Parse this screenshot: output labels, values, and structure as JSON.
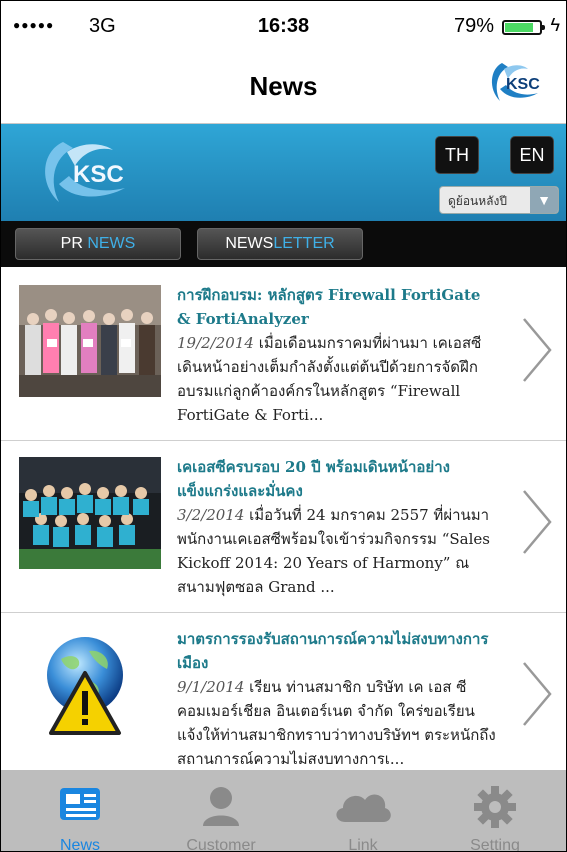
{
  "status_bar": {
    "signal_dots": "●●●●●",
    "network": "3G",
    "time": "16:38",
    "battery_percent": "79%",
    "battery_level": 0.79,
    "charging_icon": "bolt-icon"
  },
  "nav": {
    "title": "News",
    "logo_text": "KSC"
  },
  "banner": {
    "logo_text": "KSC",
    "lang_th": "TH",
    "lang_en": "EN",
    "year_select": "ดูย้อนหลังปี"
  },
  "tabs": {
    "pr_a": "PR ",
    "pr_b": "NEWS",
    "nl_a": "NEWS",
    "nl_b": "LETTER"
  },
  "news": [
    {
      "title": "การฝึกอบรม: หลักสูตร Firewall FortiGate & FortiAnalyzer",
      "date": "19/2/2014",
      "excerpt": "  เมื่อเดือนมกราคมที่ผ่านมา เคเอสซีเดินหน้าอย่างเต็มกำลังตั้งแต่ต้นปีด้วยการจัดฝึกอบรมแก่ลูกค้าองค์กรในหลักสูตร “Firewall FortiGate & Forti..."
    },
    {
      "title": "เคเอสซีครบรอบ 20 ปี พร้อมเดินหน้าอย่างแข็งแกร่งและมั่นคง",
      "date": "3/2/2014",
      "excerpt": "  เมื่อวันที่ 24 มกราคม 2557 ที่ผ่านมา พนักงานเคเอสซีพร้อมใจเข้าร่วมกิจกรรม “Sales Kickoff 2014: 20 Years of Harmony” ณ สนามฟุตซอล Grand ..."
    },
    {
      "title": "มาตรการรองรับสถานการณ์ความไม่สงบทางการเมือง",
      "date": "9/1/2014",
      "excerpt": " เรียน ท่านสมาชิก บริษัท เค เอส ซี คอมเมอร์เชียล อินเตอร์เนต จำกัด ใคร่ขอเรียนแจ้งให้ท่านสมาชิกทราบว่าทางบริษัทฯ ตระหนักถึงสถานการณ์ความไม่สงบทางการเ..."
    }
  ],
  "tabbar": {
    "news": "News",
    "customer": "Customer",
    "link": "Link",
    "setting": "Setting"
  },
  "colors": {
    "accent": "#1a86e0",
    "banner": "#2a9bd0",
    "title_link": "#1d7a8a"
  }
}
